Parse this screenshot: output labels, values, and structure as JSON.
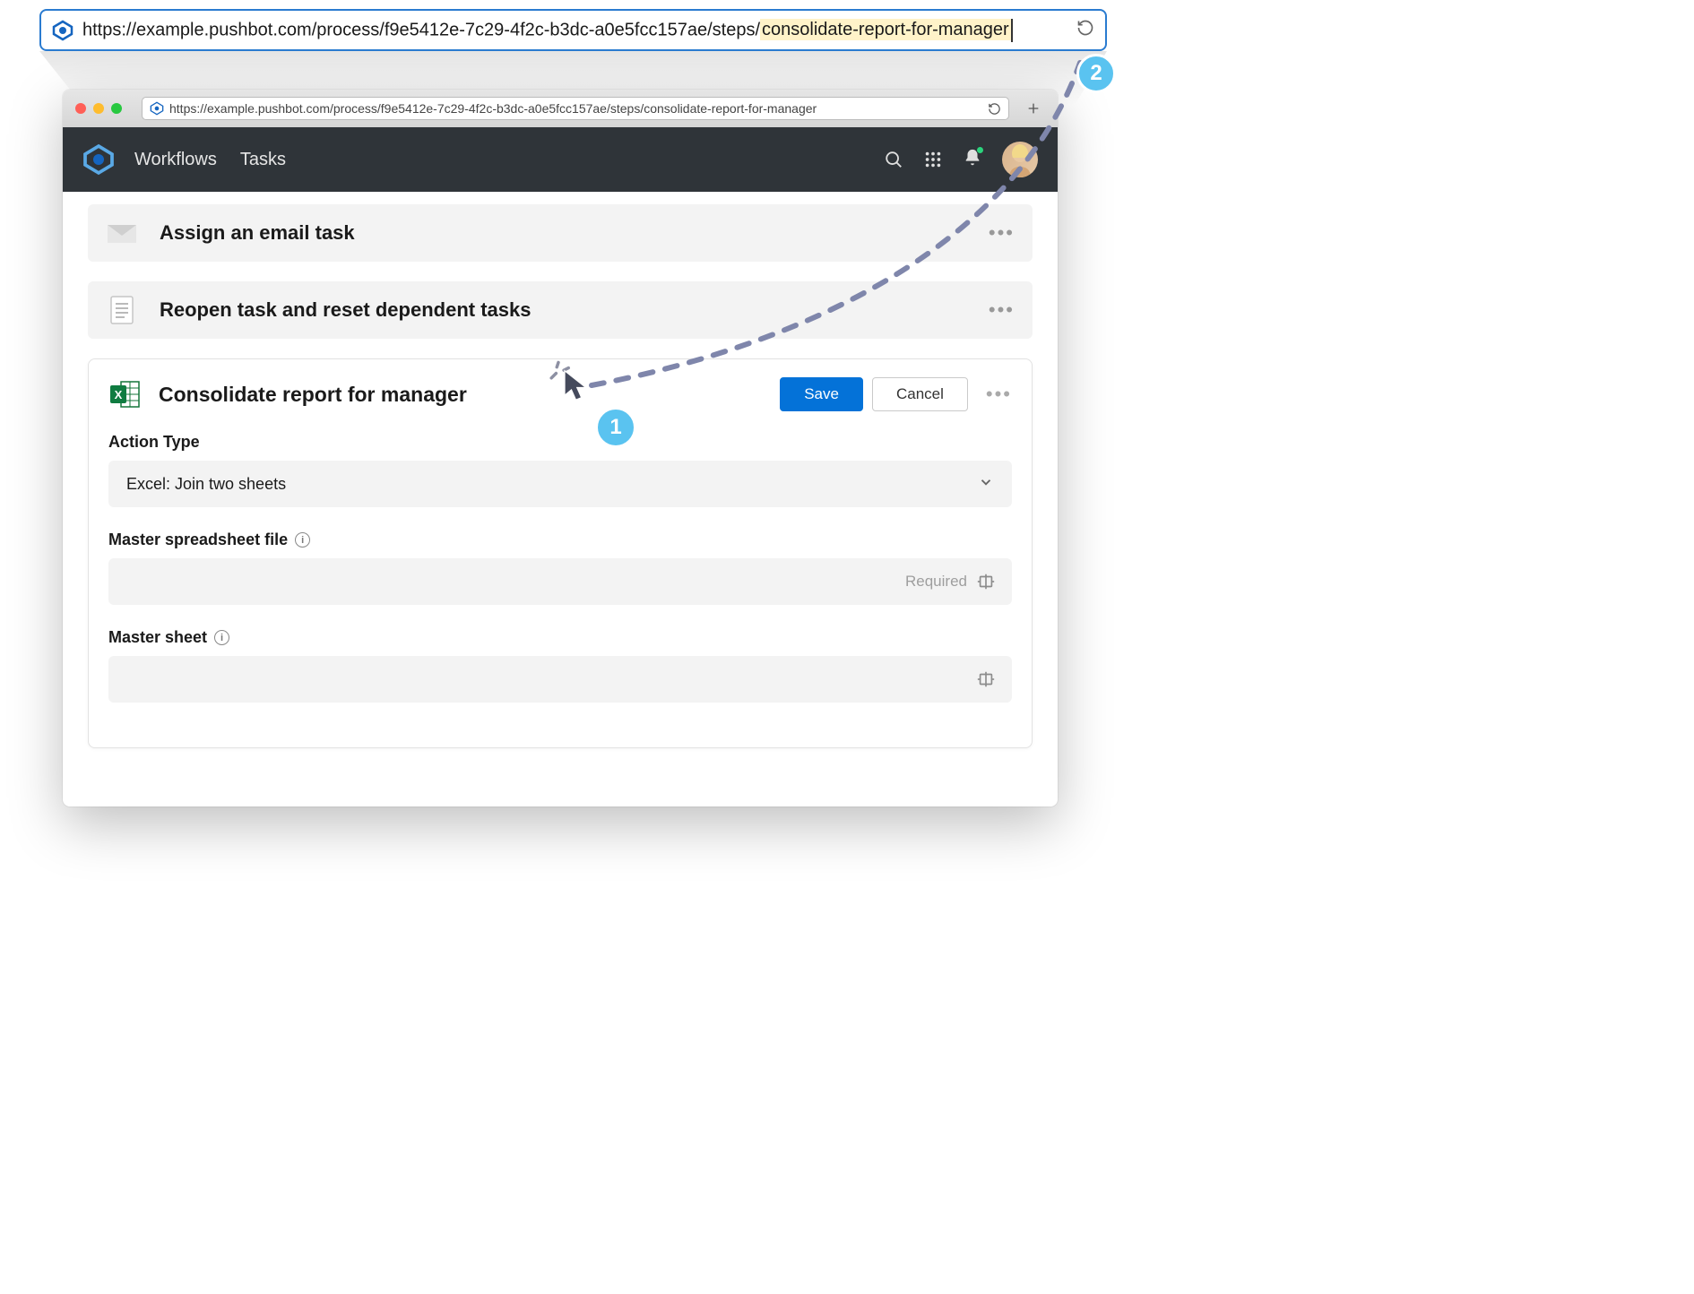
{
  "top_url": {
    "base": "https://example.pushbot.com/process/f9e5412e-7c29-4f2c-b3dc-a0e5fcc157ae/steps/",
    "highlighted_segment": "consolidate-report-for-manager"
  },
  "browser": {
    "url": "https://example.pushbot.com/process/f9e5412e-7c29-4f2c-b3dc-a0e5fcc157ae/steps/consolidate-report-for-manager"
  },
  "header": {
    "nav": {
      "workflows": "Workflows",
      "tasks": "Tasks"
    }
  },
  "tasks": [
    {
      "title": "Assign an email task"
    },
    {
      "title": "Reopen task and reset dependent tasks"
    }
  ],
  "main": {
    "title": "Consolidate report for manager",
    "buttons": {
      "save": "Save",
      "cancel": "Cancel"
    },
    "fields": {
      "action_type": {
        "label": "Action Type",
        "value": "Excel: Join two sheets"
      },
      "master_spreadsheet_file": {
        "label": "Master spreadsheet file",
        "required": "Required"
      },
      "master_sheet": {
        "label": "Master sheet"
      }
    }
  },
  "annotations": {
    "badge1": "1",
    "badge2": "2"
  }
}
